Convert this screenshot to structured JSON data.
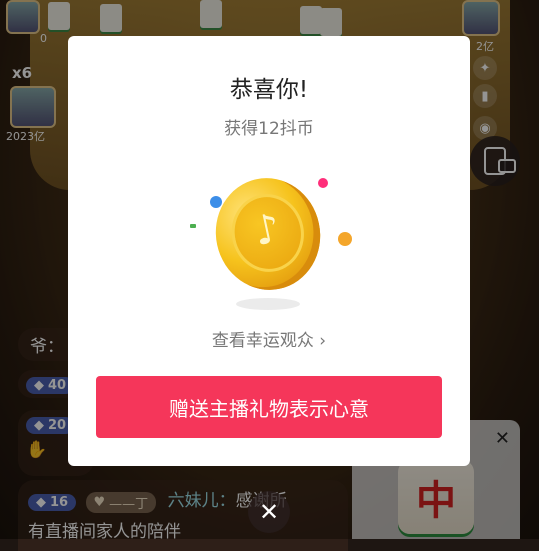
{
  "background": {
    "left_top_count": "0",
    "left_multiplier": "x6",
    "left_amount": "2023亿",
    "right_amount": "2亿",
    "chat_partial_1": "爷：",
    "chat_partial_2_level": "40",
    "chat_partial_3_level": "20",
    "chat_last": {
      "level": "16",
      "fan_badge": "——丁",
      "name": "六妹儿：",
      "text_1": "感谢所",
      "text_2": "有直播间家人的陪伴"
    }
  },
  "modal": {
    "title": "恭喜你!",
    "subtitle": "获得12抖币",
    "lucky_link": "查看幸运观众",
    "lucky_chevron": "›",
    "cta_label": "赠送主播礼物表示心意"
  },
  "promo": {
    "close": "✕",
    "tile_char": "中"
  },
  "close_button": "✕",
  "colors": {
    "cta": "#f5365a",
    "coin_gold": "#f6c31d",
    "dot_pink": "#ff2e7a",
    "dot_blue": "#3c8ee8",
    "dot_orange": "#f4a62b"
  },
  "icons": {
    "coin": "tiktok-coin-icon",
    "phone": "screen-rotate-icon",
    "close": "close-icon"
  }
}
